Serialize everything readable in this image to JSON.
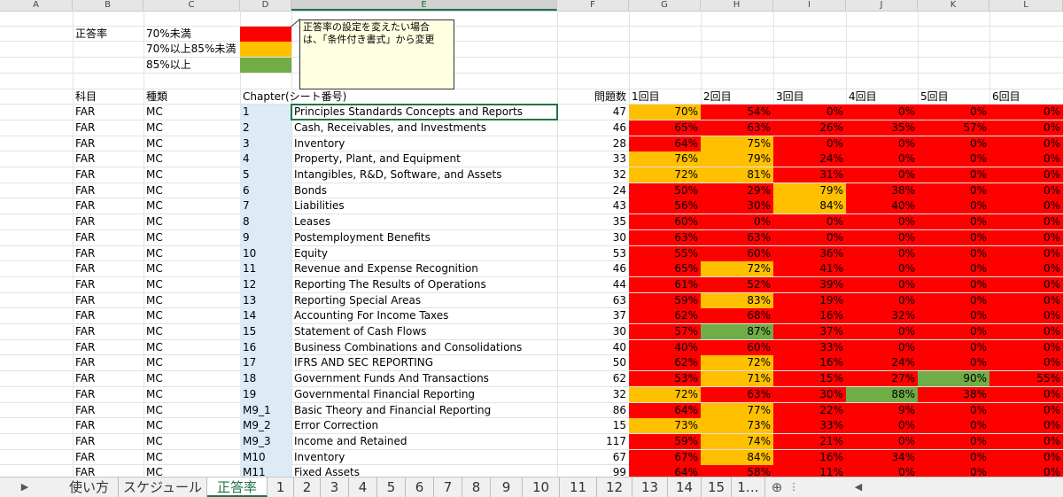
{
  "columns": [
    "A",
    "B",
    "C",
    "D",
    "E",
    "F",
    "G",
    "H",
    "I",
    "J",
    "K",
    "L"
  ],
  "legend": {
    "label": "正答率",
    "items": [
      {
        "text": "70%未満",
        "color": "#ff0000"
      },
      {
        "text": "70%以上85%未満",
        "color": "#ffc000"
      },
      {
        "text": "85%以上",
        "color": "#70ad47"
      }
    ]
  },
  "comment": {
    "line1": "正答率の設定を変えたい場合",
    "line2": "は、「条件付き書式」から変更"
  },
  "headers": {
    "subject": "科目",
    "type": "種類",
    "chapter": "Chapter(シート番号)",
    "count": "問題数",
    "rounds": [
      "1回目",
      "2回目",
      "3回目",
      "4回目",
      "5回目",
      "6回目"
    ]
  },
  "colors": {
    "red": "#ff0000",
    "yellow": "#ffc000",
    "green": "#70ad47"
  },
  "rows": [
    {
      "s": "FAR",
      "t": "MC",
      "ch": "1",
      "title": "Principles Standards Concepts and Reports",
      "n": "47",
      "p": [
        "70%",
        "54%",
        "0%",
        "0%",
        "0%",
        "0%"
      ]
    },
    {
      "s": "FAR",
      "t": "MC",
      "ch": "2",
      "title": "Cash, Receivables, and Investments",
      "n": "46",
      "p": [
        "65%",
        "63%",
        "26%",
        "35%",
        "57%",
        "0%"
      ]
    },
    {
      "s": "FAR",
      "t": "MC",
      "ch": "3",
      "title": "Inventory",
      "n": "28",
      "p": [
        "64%",
        "75%",
        "0%",
        "0%",
        "0%",
        "0%"
      ]
    },
    {
      "s": "FAR",
      "t": "MC",
      "ch": "4",
      "title": "Property, Plant, and Equipment",
      "n": "33",
      "p": [
        "76%",
        "79%",
        "24%",
        "0%",
        "0%",
        "0%"
      ]
    },
    {
      "s": "FAR",
      "t": "MC",
      "ch": "5",
      "title": "Intangibles, R&D, Software, and Assets",
      "n": "32",
      "p": [
        "72%",
        "81%",
        "31%",
        "0%",
        "0%",
        "0%"
      ]
    },
    {
      "s": "FAR",
      "t": "MC",
      "ch": "6",
      "title": "Bonds",
      "n": "24",
      "p": [
        "50%",
        "29%",
        "79%",
        "38%",
        "0%",
        "0%"
      ]
    },
    {
      "s": "FAR",
      "t": "MC",
      "ch": "7",
      "title": "Liabilities",
      "n": "43",
      "p": [
        "56%",
        "30%",
        "84%",
        "40%",
        "0%",
        "0%"
      ]
    },
    {
      "s": "FAR",
      "t": "MC",
      "ch": "8",
      "title": "Leases",
      "n": "35",
      "p": [
        "60%",
        "0%",
        "0%",
        "0%",
        "0%",
        "0%"
      ]
    },
    {
      "s": "FAR",
      "t": "MC",
      "ch": "9",
      "title": "Postemployment Benefits",
      "n": "30",
      "p": [
        "63%",
        "63%",
        "0%",
        "0%",
        "0%",
        "0%"
      ]
    },
    {
      "s": "FAR",
      "t": "MC",
      "ch": "10",
      "title": "Equity",
      "n": "53",
      "p": [
        "55%",
        "60%",
        "36%",
        "0%",
        "0%",
        "0%"
      ]
    },
    {
      "s": "FAR",
      "t": "MC",
      "ch": "11",
      "title": "Revenue and Expense Recognition",
      "n": "46",
      "p": [
        "65%",
        "72%",
        "41%",
        "0%",
        "0%",
        "0%"
      ]
    },
    {
      "s": "FAR",
      "t": "MC",
      "ch": "12",
      "title": "Reporting The Results of Operations",
      "n": "44",
      "p": [
        "61%",
        "52%",
        "39%",
        "0%",
        "0%",
        "0%"
      ]
    },
    {
      "s": "FAR",
      "t": "MC",
      "ch": "13",
      "title": "Reporting Special Areas",
      "n": "63",
      "p": [
        "59%",
        "83%",
        "19%",
        "0%",
        "0%",
        "0%"
      ]
    },
    {
      "s": "FAR",
      "t": "MC",
      "ch": "14",
      "title": "Accounting For Income Taxes",
      "n": "37",
      "p": [
        "62%",
        "68%",
        "16%",
        "32%",
        "0%",
        "0%"
      ]
    },
    {
      "s": "FAR",
      "t": "MC",
      "ch": "15",
      "title": "Statement of Cash Flows",
      "n": "30",
      "p": [
        "57%",
        "87%",
        "37%",
        "0%",
        "0%",
        "0%"
      ]
    },
    {
      "s": "FAR",
      "t": "MC",
      "ch": "16",
      "title": "Business Combinations and Consolidations",
      "n": "40",
      "p": [
        "40%",
        "60%",
        "33%",
        "0%",
        "0%",
        "0%"
      ]
    },
    {
      "s": "FAR",
      "t": "MC",
      "ch": "17",
      "title": "IFRS AND SEC REPORTING",
      "n": "50",
      "p": [
        "62%",
        "72%",
        "16%",
        "24%",
        "0%",
        "0%"
      ]
    },
    {
      "s": "FAR",
      "t": "MC",
      "ch": "18",
      "title": "Government Funds And Transactions",
      "n": "62",
      "p": [
        "53%",
        "71%",
        "15%",
        "27%",
        "90%",
        "55%"
      ]
    },
    {
      "s": "FAR",
      "t": "MC",
      "ch": "19",
      "title": "Governmental Financial Reporting",
      "n": "32",
      "p": [
        "72%",
        "63%",
        "30%",
        "88%",
        "38%",
        "0%"
      ]
    },
    {
      "s": "FAR",
      "t": "MC",
      "ch": "M9_1",
      "title": "Basic Theory and Financial Reporting",
      "n": "86",
      "p": [
        "64%",
        "77%",
        "22%",
        "9%",
        "0%",
        "0%"
      ]
    },
    {
      "s": "FAR",
      "t": "MC",
      "ch": "M9_2",
      "title": "Error Correction",
      "n": "15",
      "p": [
        "73%",
        "73%",
        "33%",
        "0%",
        "0%",
        "0%"
      ]
    },
    {
      "s": "FAR",
      "t": "MC",
      "ch": "M9_3",
      "title": "Income and Retained",
      "n": "117",
      "p": [
        "59%",
        "74%",
        "21%",
        "0%",
        "0%",
        "0%"
      ]
    },
    {
      "s": "FAR",
      "t": "MC",
      "ch": "M10",
      "title": "Inventory",
      "n": "67",
      "p": [
        "67%",
        "84%",
        "16%",
        "34%",
        "0%",
        "0%"
      ]
    },
    {
      "s": "FAR",
      "t": "MC",
      "ch": "M11",
      "title": "Fixed Assets",
      "n": "99",
      "p": [
        "64%",
        "58%",
        "11%",
        "0%",
        "0%",
        "0%"
      ]
    }
  ],
  "tabs": [
    "使い方",
    "スケジュール",
    "正答率",
    "1",
    "2",
    "3",
    "4",
    "5",
    "6",
    "7",
    "8",
    "9",
    "10",
    "11",
    "12",
    "13",
    "14",
    "15",
    "1…"
  ],
  "active_tab": "正答率"
}
